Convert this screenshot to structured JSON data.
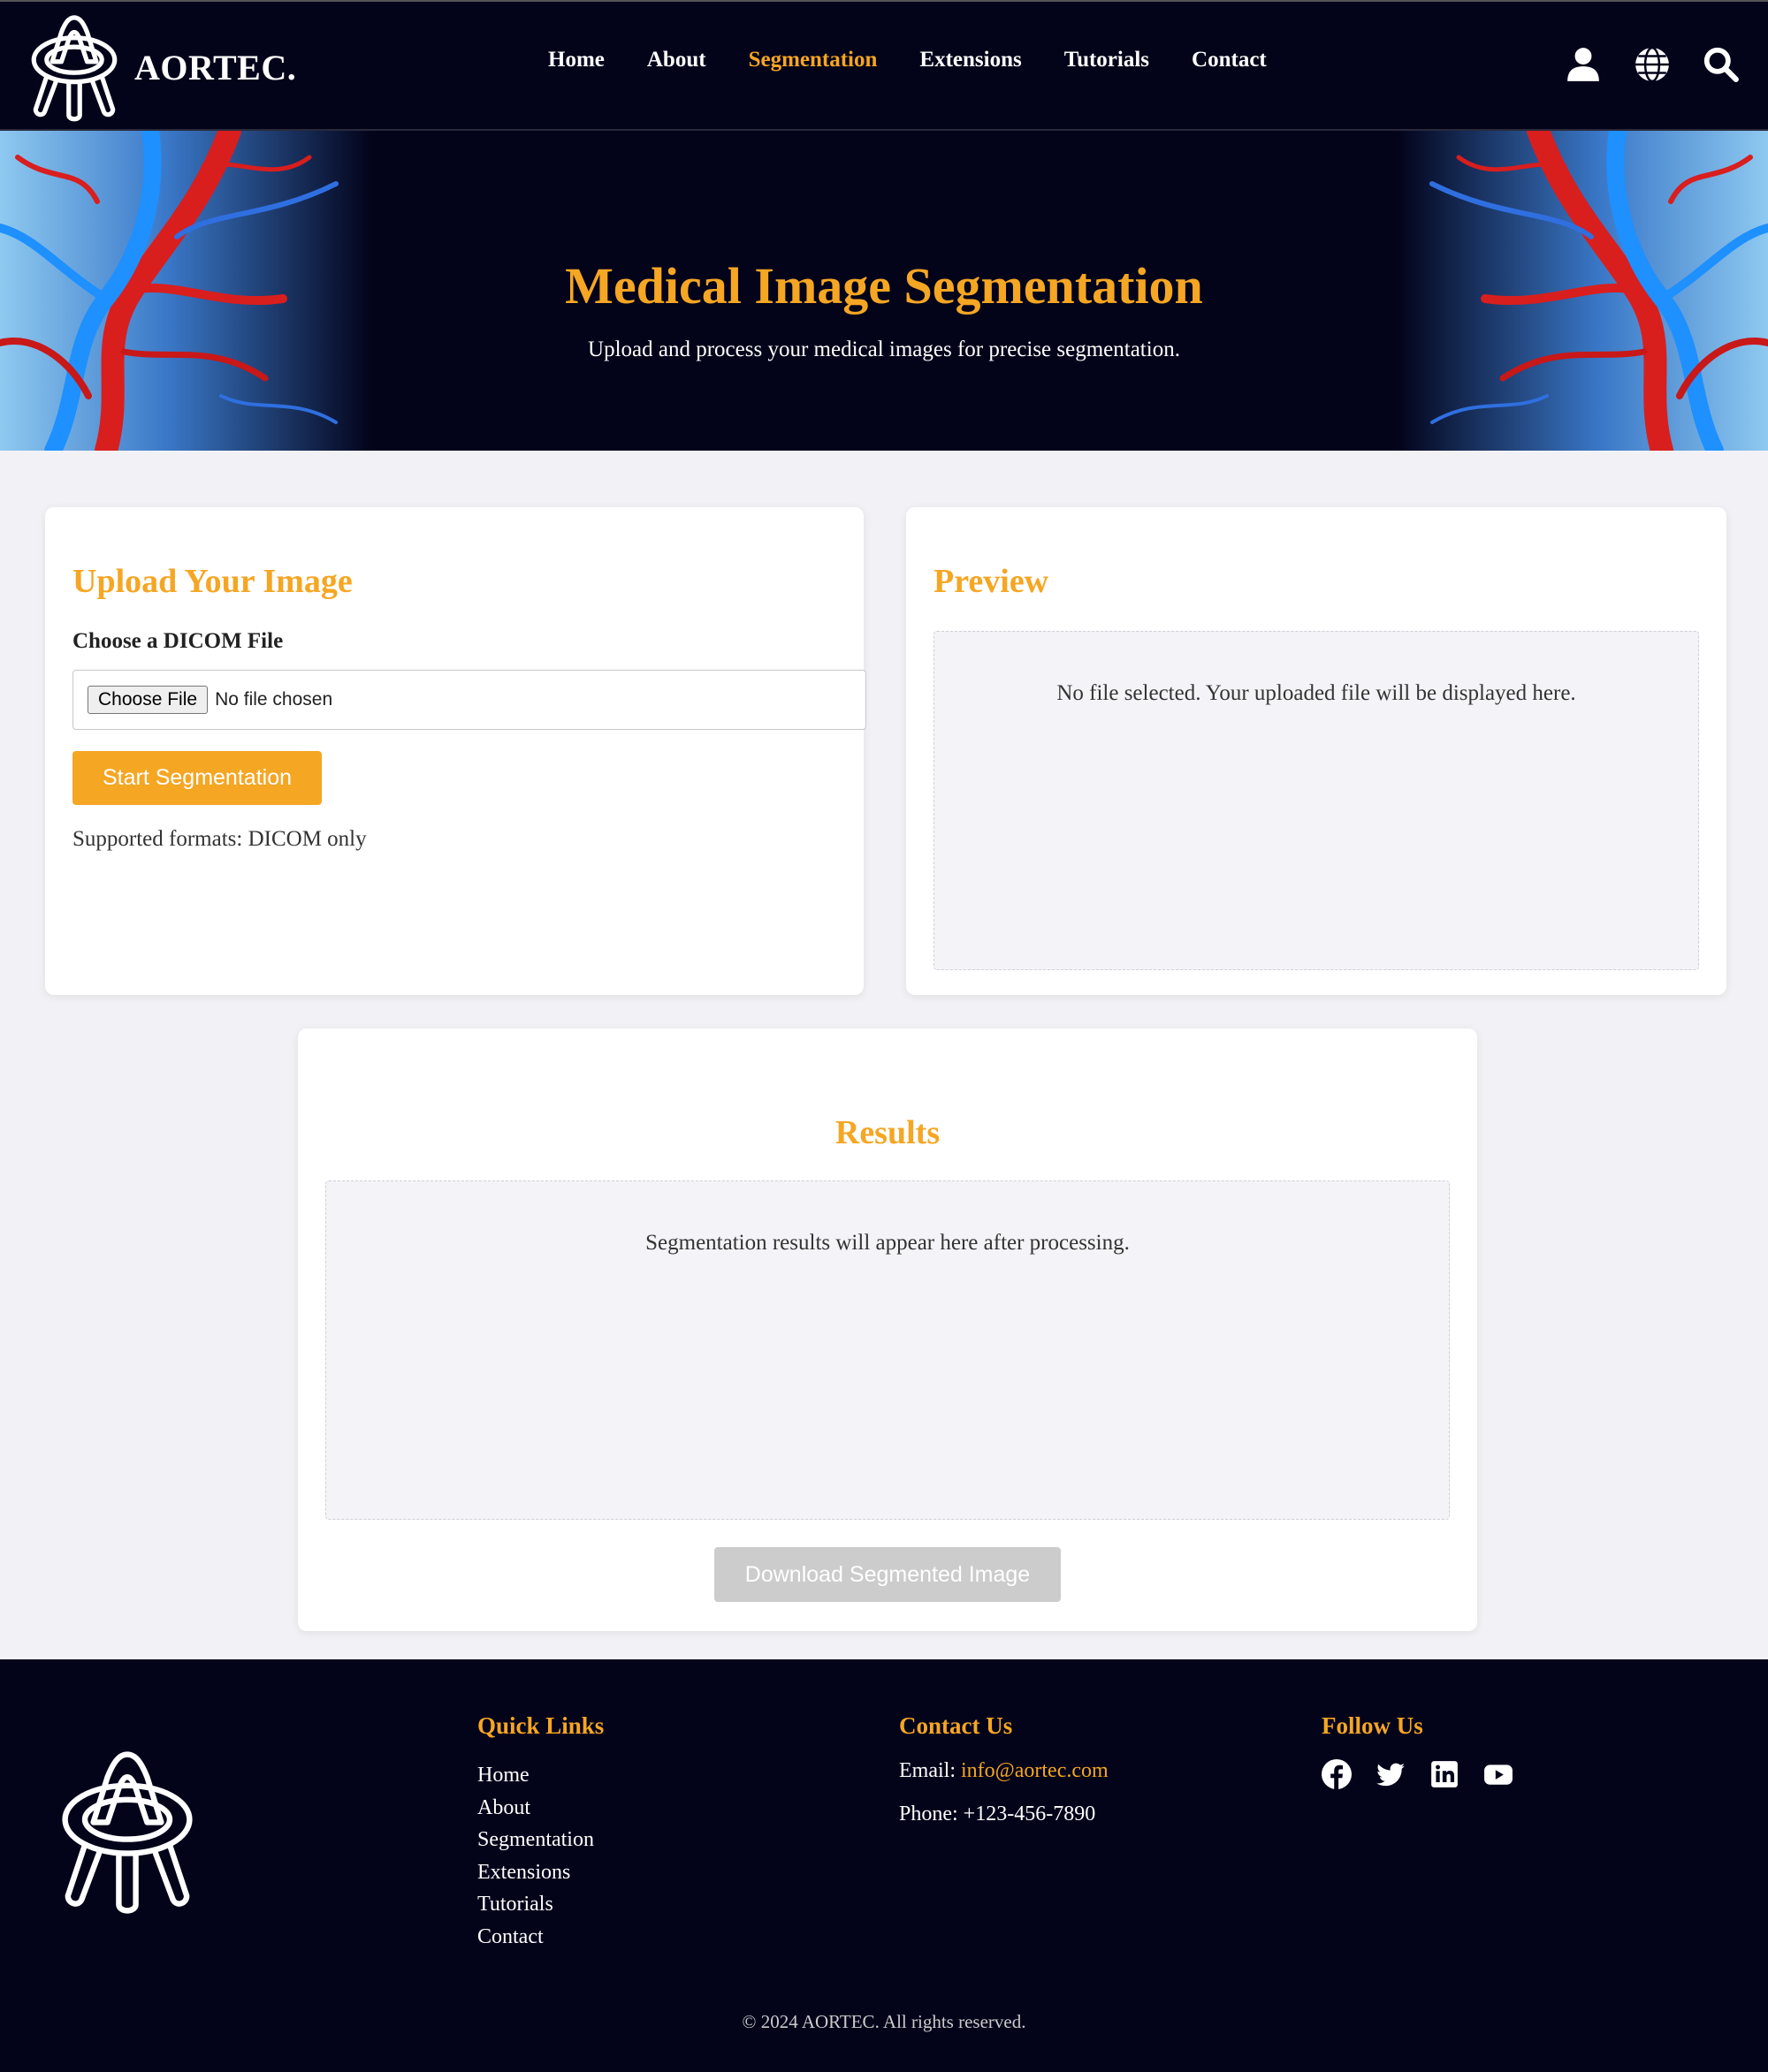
{
  "brand": {
    "name": "AORTEC."
  },
  "nav": {
    "links": [
      "Home",
      "About",
      "Segmentation",
      "Extensions",
      "Tutorials",
      "Contact"
    ],
    "active": "Segmentation",
    "icons": [
      "user-icon",
      "globe-icon",
      "search-icon"
    ]
  },
  "hero": {
    "title": "Medical Image Segmentation",
    "subtitle": "Upload and process your medical images for precise segmentation."
  },
  "upload": {
    "title": "Upload Your Image",
    "label": "Choose a DICOM File",
    "choose_button": "Choose File",
    "file_status": "No file chosen",
    "start_button": "Start Segmentation",
    "formats": "Supported formats: DICOM only"
  },
  "preview": {
    "title": "Preview",
    "placeholder": "No file selected. Your uploaded file will be displayed here."
  },
  "results": {
    "title": "Results",
    "placeholder": "Segmentation results will appear here after processing.",
    "download_button": "Download Segmented Image"
  },
  "footer": {
    "quick_links": {
      "heading": "Quick Links",
      "items": [
        "Home",
        "About",
        "Segmentation",
        "Extensions",
        "Tutorials",
        "Contact"
      ]
    },
    "contact": {
      "heading": "Contact Us",
      "email_label": "Email:",
      "email": "info@aortec.com",
      "phone": "Phone: +123-456-7890"
    },
    "follow": {
      "heading": "Follow Us",
      "icons": [
        "facebook-icon",
        "twitter-icon",
        "linkedin-icon",
        "youtube-icon"
      ]
    },
    "copyright": "© 2024 AORTEC. All rights reserved."
  },
  "colors": {
    "accent": "#f5a623",
    "navy": "#03031a",
    "page_bg": "#f2f2f6",
    "disabled": "#cccccc"
  }
}
